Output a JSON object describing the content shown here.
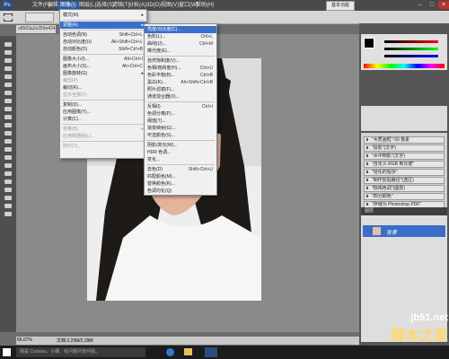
{
  "menubar": {
    "items": [
      "文件(F)",
      "编辑(E)",
      "图像(I)",
      "图层(L)",
      "选择(S)",
      "滤镜(T)",
      "分析(A)",
      "3D(D)",
      "视图(V)",
      "窗口(W)",
      "帮助(H)"
    ],
    "zoom": "66.7",
    "workspace": "基本功能"
  },
  "document": {
    "tab": "u8563a1e359e424"
  },
  "image_menu": {
    "items": [
      {
        "label": "模式(M)",
        "shortcut": "",
        "submenu": true
      },
      {
        "sep": true
      },
      {
        "label": "调整(A)",
        "shortcut": "",
        "submenu": true,
        "highlight": true
      },
      {
        "sep": true
      },
      {
        "label": "自动色调(N)",
        "shortcut": "Shift+Ctrl+L"
      },
      {
        "label": "自动对比度(U)",
        "shortcut": "Alt+Shift+Ctrl+L"
      },
      {
        "label": "自动颜色(O)",
        "shortcut": "Shift+Ctrl+B"
      },
      {
        "sep": true
      },
      {
        "label": "图像大小(I)...",
        "shortcut": "Alt+Ctrl+I"
      },
      {
        "label": "画布大小(S)...",
        "shortcut": "Alt+Ctrl+C"
      },
      {
        "label": "图像旋转(G)",
        "shortcut": "",
        "submenu": true
      },
      {
        "label": "裁剪(P)",
        "shortcut": "",
        "disabled": true
      },
      {
        "label": "裁切(R)...",
        "shortcut": ""
      },
      {
        "label": "显示全部(V)",
        "shortcut": "",
        "disabled": true
      },
      {
        "sep": true
      },
      {
        "label": "复制(D)...",
        "shortcut": ""
      },
      {
        "label": "应用图像(Y)...",
        "shortcut": ""
      },
      {
        "label": "计算(C)...",
        "shortcut": ""
      },
      {
        "sep": true
      },
      {
        "label": "变量(B)",
        "shortcut": "",
        "submenu": true,
        "disabled": true
      },
      {
        "label": "应用数据组(L)...",
        "shortcut": "",
        "disabled": true
      },
      {
        "sep": true
      },
      {
        "label": "陷印(T)...",
        "shortcut": "",
        "disabled": true
      }
    ]
  },
  "adjust_menu": {
    "items": [
      {
        "label": "亮度/对比度(C)...",
        "shortcut": "",
        "highlight": true
      },
      {
        "label": "色阶(L)...",
        "shortcut": "Ctrl+L"
      },
      {
        "label": "曲线(U)...",
        "shortcut": "Ctrl+M"
      },
      {
        "label": "曝光度(E)...",
        "shortcut": ""
      },
      {
        "sep": true
      },
      {
        "label": "自然饱和度(V)...",
        "shortcut": ""
      },
      {
        "label": "色相/饱和度(H)...",
        "shortcut": "Ctrl+U"
      },
      {
        "label": "色彩平衡(B)...",
        "shortcut": "Ctrl+B"
      },
      {
        "label": "黑白(K)...",
        "shortcut": "Alt+Shift+Ctrl+B"
      },
      {
        "label": "照片滤镜(F)...",
        "shortcut": ""
      },
      {
        "label": "通道混合器(X)...",
        "shortcut": ""
      },
      {
        "sep": true
      },
      {
        "label": "反相(I)",
        "shortcut": "Ctrl+I"
      },
      {
        "label": "色调分离(P)...",
        "shortcut": ""
      },
      {
        "label": "阈值(T)...",
        "shortcut": ""
      },
      {
        "label": "渐变映射(G)...",
        "shortcut": ""
      },
      {
        "label": "可选颜色(S)...",
        "shortcut": ""
      },
      {
        "sep": true
      },
      {
        "label": "阴影/高光(W)...",
        "shortcut": ""
      },
      {
        "label": "HDR 色调...",
        "shortcut": ""
      },
      {
        "label": "变化...",
        "shortcut": ""
      },
      {
        "sep": true
      },
      {
        "label": "去色(D)",
        "shortcut": "Shift+Ctrl+U"
      },
      {
        "label": "匹配颜色(M)...",
        "shortcut": ""
      },
      {
        "label": "替换颜色(R)...",
        "shortcut": ""
      },
      {
        "label": "色调均化(Q)",
        "shortcut": ""
      }
    ]
  },
  "actions_panel": {
    "title": "动作",
    "rows": [
      "\"木质画框\"-50 像素",
      "\"投影\"(文字)",
      "\"水中倒影\"(文字)",
      "\"自定义 RGB 到灰度\"",
      "\"熔化的铅块\"",
      "\"制作剪贴路径\"(选区)",
      "\"棕褐色调\"(图层)",
      "\"四分颜色\"",
      "\"存储为 Photoshop PDF\""
    ]
  },
  "layers_panel": {
    "tabs": [
      "图层"
    ],
    "layer_name": "背景"
  },
  "status": {
    "zoom": "66.67%",
    "doc": "文档:2.29M/2.29M"
  },
  "taskbar": {
    "search": "我是 Cortana，小娜。有问题尽管问我。"
  },
  "watermark": {
    "line1": "jb51.net",
    "line2": "脚本之家"
  }
}
